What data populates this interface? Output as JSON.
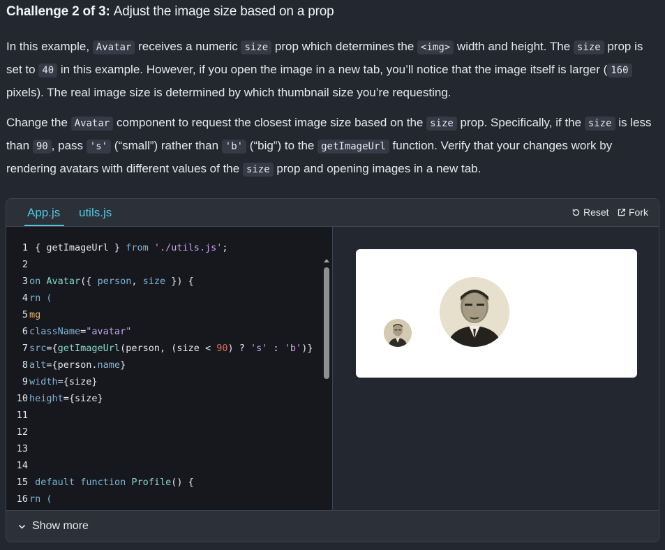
{
  "challenge": {
    "heading_bold": "Challenge 2 of 3:",
    "heading_rest": "Adjust the image size based on a prop"
  },
  "para1": {
    "t1": "In this example, ",
    "c1": "Avatar",
    "t2": " receives a numeric ",
    "c2": "size",
    "t3": " prop which determines the ",
    "c3": "<img>",
    "t4": " width and height. The ",
    "c4": "size",
    "t5": " prop is set to ",
    "c5": "40",
    "t6": " in this example. However, if you open the image in a new tab, you’ll notice that the image itself is larger (",
    "c6": "160",
    "t7": " pixels). The real image size is determined by which thumbnail size you’re requesting."
  },
  "para2": {
    "t1": "Change the ",
    "c1": "Avatar",
    "t2": " component to request the closest image size based on the ",
    "c2": "size",
    "t3": " prop. Specifically, if the ",
    "c3": "size",
    "t4": " is less than ",
    "c4": "90",
    "t5": ", pass ",
    "c5": "'s'",
    "t6": " (“small”) rather than ",
    "c6": "'b'",
    "t7": " (“big”) to the ",
    "c7": "getImageUrl",
    "t8": " function. Verify that your changes work by rendering avatars with different values of the ",
    "c8": "size",
    "t9": " prop and opening images in a new tab."
  },
  "sandbox": {
    "tabs": [
      "App.js",
      "utils.js"
    ],
    "reset_label": "Reset",
    "fork_label": "Fork",
    "show_more_label": "Show more",
    "line_numbers": [
      "1",
      "2",
      "3",
      "4",
      "5",
      "6",
      "7",
      "8",
      "9",
      "10",
      "11",
      "12",
      "13",
      "14",
      "15",
      "16"
    ],
    "code": {
      "l1_a": "{ getImageUrl } ",
      "l1_b": "from",
      "l1_c": " ",
      "l1_d": "'./utils.js'",
      "l1_e": ";",
      "l3_a": "on ",
      "l3_b": "Avatar",
      "l3_c": "({ ",
      "l3_d": "person",
      "l3_e": ", ",
      "l3_f": "size",
      "l3_g": " }) {",
      "l4": "rn (",
      "l5": "mg",
      "l6_a": "className",
      "l6_b": "=",
      "l6_c": "\"avatar\"",
      "l7_a": "src",
      "l7_b": "={",
      "l7_c": "getImageUrl",
      "l7_d": "(person, (size < ",
      "l7_e": "90",
      "l7_f": ") ? ",
      "l7_g": "'s'",
      "l7_h": " : ",
      "l7_i": "'b'",
      "l7_j": ")}",
      "l8_a": "alt",
      "l8_b": "={person.",
      "l8_c": "name",
      "l8_d": "}",
      "l9_a": "width",
      "l9_b": "={size}",
      "l10_a": "height",
      "l10_b": "={size}",
      "l15_a": "default",
      "l15_b": " ",
      "l15_c": "function",
      "l15_d": " ",
      "l15_e": "Profile",
      "l15_f": "() {",
      "l16": "rn ("
    }
  },
  "preview": {
    "avatar_small_alt": "person-photo-small",
    "avatar_big_alt": "person-photo-big"
  },
  "colors": {
    "background": "#23272f",
    "accent": "#58c4dc",
    "code_bg": "#16181d"
  }
}
